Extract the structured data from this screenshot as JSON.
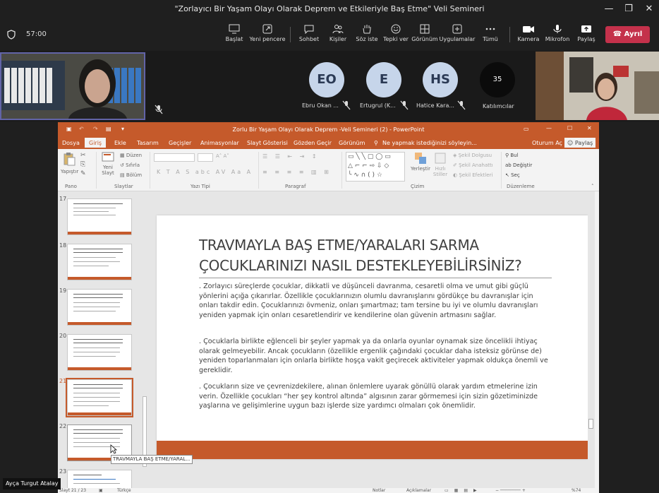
{
  "window": {
    "title": "\"Zorlayıcı Bir Yaşam Olayı Olarak Deprem ve Etkileriyle Baş Etme\" Veli Semineri"
  },
  "call": {
    "timer": "57:00",
    "toolbar": [
      {
        "label": "Başlat",
        "icon": "share-screen-icon"
      },
      {
        "label": "Yeni pencere",
        "icon": "new-window-icon"
      },
      {
        "label": "Sohbet",
        "icon": "chat-icon"
      },
      {
        "label": "Kişiler",
        "icon": "people-icon"
      },
      {
        "label": "Söz iste",
        "icon": "raise-hand-icon"
      },
      {
        "label": "Tepki ver",
        "icon": "react-icon"
      },
      {
        "label": "Görünüm",
        "icon": "view-icon"
      },
      {
        "label": "Uygulamalar",
        "icon": "apps-icon"
      },
      {
        "label": "Tümü",
        "icon": "more-icon"
      },
      {
        "label": "Kamera",
        "icon": "camera-icon"
      },
      {
        "label": "Mikrofon",
        "icon": "mic-icon"
      },
      {
        "label": "Paylaş",
        "icon": "share-icon"
      }
    ],
    "leave_label": "Ayrıl",
    "participants": [
      {
        "initials": "EO",
        "name": "Ebru Okan ..."
      },
      {
        "initials": "E",
        "name": "Ertugrul (K..."
      },
      {
        "initials": "HS",
        "name": "Hatice Kara..."
      }
    ],
    "more_count": "35",
    "more_label": "Katılımcılar",
    "presenter_name": "Ayça Turgut Atalay"
  },
  "ppt": {
    "title": "Zorlu Bir Yaşam Olayı Olarak Deprem -Veli Semineri (2)  -  PowerPoint",
    "account": "Oturum Aç",
    "share": "Paylaş",
    "tabs": [
      "Dosya",
      "Giriş",
      "Ekle",
      "Tasarım",
      "Geçişler",
      "Animasyonlar",
      "Slayt Gösterisi",
      "Gözden Geçir",
      "Görünüm"
    ],
    "tell_me": "Ne yapmak istediğinizi söyleyin...",
    "ribbon": {
      "paste": "Yapıştır",
      "new_slide": "Yeni Slayt",
      "layout": "Düzen",
      "reset": "Sıfırla",
      "section": "Bölüm",
      "arrange": "Yerleştir",
      "quick_styles": "Hızlı Stiller",
      "shape_fill": "Şekil Dolgusu",
      "shape_outline": "Şekil Anahattı",
      "shape_effects": "Şekil Efektleri",
      "find": "Bul",
      "replace": "Değiştir",
      "select": "Seç",
      "group_labels": [
        "Pano",
        "Slaytlar",
        "Yazı Tipi",
        "Paragraf",
        "Çizim",
        "Düzenleme"
      ]
    },
    "thumb_numbers": [
      "17",
      "18",
      "19",
      "20",
      "21",
      "22",
      "23"
    ],
    "selected_slide": "21",
    "tooltip": "TRAVMAYLA BAŞ ETME/YARAL...",
    "slide": {
      "title_line1": "TRAVMAYLA BAŞ ETME/YARALARI SARMA",
      "title_line2": "ÇOCUKLARINIZI NASIL DESTEKLEYEBİLİRSİNİZ?",
      "paragraphs": [
        ". Zorlayıcı süreçlerde çocuklar, dikkatli ve düşünceli davranma, cesaretli olma ve umut gibi güçlü yönlerini açığa çıkarırlar. Özellikle çocuklarınızın olumlu davranışlarını gördükçe bu davranışlar için onları takdir edin. Çocuklarınızı övmeniz, onları şımartmaz; tam tersine bu iyi ve olumlu davranışları yeniden yapmak için onları cesaretlendirir ve kendilerine olan güvenin artmasını sağlar.",
        ". Çocuklarla birlikte eğlenceli bir şeyler yapmak ya da onlarla oyunlar oynamak size öncelikli ihtiyaç olarak gelmeyebilir. Ancak çocukların (özellikle ergenlik çağındaki çocuklar daha isteksiz görünse de) yeniden toparlanmaları için onlarla birlikte hoşça vakit geçirecek aktiviteler yapmak oldukça önemli ve gereklidir.",
        ". Çocukların size ve çevrenizdekilere, alınan önlemlere uyarak gönüllü olarak yardım etmelerine izin verin. Özellikle çocukları “her şey kontrol altında” algısının zarar görmemesi için sizin gözetiminizde yaşlarına ve gelişimlerine uygun bazı işlerde size yardımcı olmaları çok önemlidir."
      ]
    },
    "status": {
      "slide_info": "Slayt 21 / 23",
      "language": "Türkçe",
      "notes": "Notlar",
      "comments": "Açıklamalar",
      "zoom": "%74"
    }
  }
}
